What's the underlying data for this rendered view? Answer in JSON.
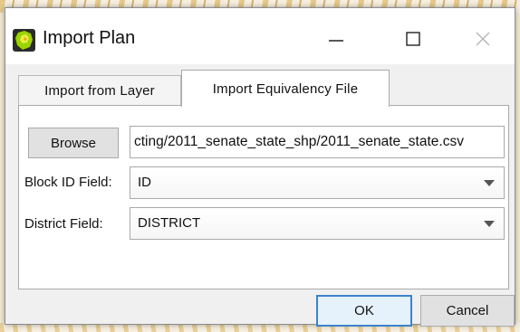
{
  "window": {
    "title": "Import Plan",
    "icon": "qgis-plugin-icon"
  },
  "titlebar_controls": [
    "minimize-icon",
    "maximize-icon",
    "close-icon"
  ],
  "tabs": [
    {
      "label": "Import from Layer",
      "active": false
    },
    {
      "label": "Import Equivalency File",
      "active": true
    }
  ],
  "form": {
    "browse_label": "Browse",
    "file_path": "cting/2011_senate_state_shp/2011_senate_state.csv",
    "block_id_label": "Block ID Field:",
    "block_id_value": "ID",
    "district_label": "District Field:",
    "district_value": "DISTRICT"
  },
  "buttons": {
    "ok": "OK",
    "cancel": "Cancel"
  },
  "colors": {
    "accent": "#3c84cc",
    "panel_bg": "#ffffff",
    "dialog_bg": "#f0f0f0"
  }
}
